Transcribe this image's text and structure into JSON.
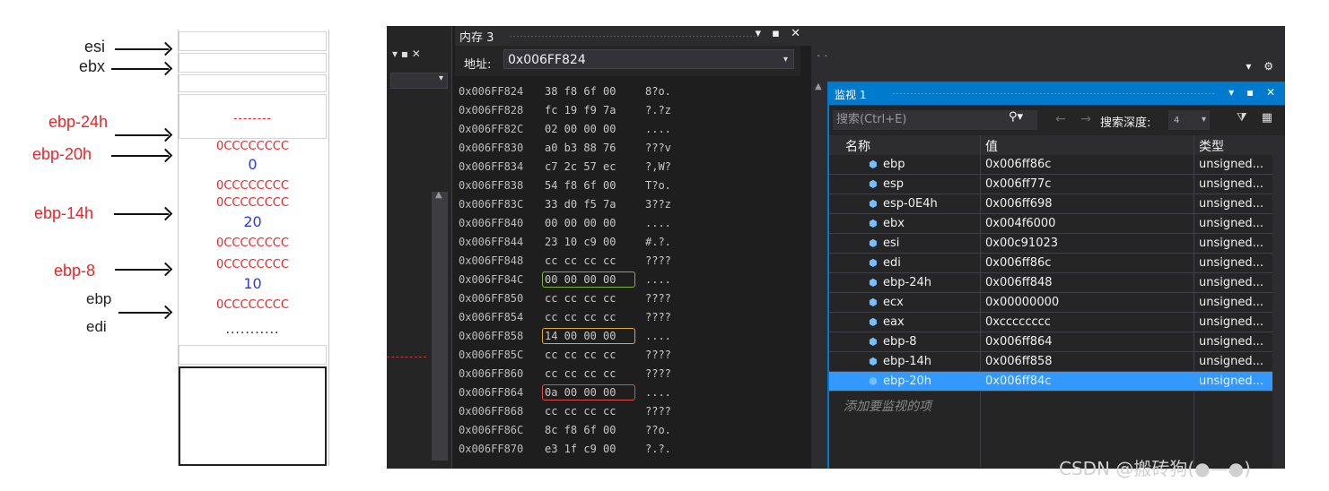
{
  "diagram": {
    "labels": {
      "esi": "esi",
      "ebx": "ebx",
      "ebp_24h": "ebp-24h",
      "ebp_20h": "ebp-20h",
      "ebp_14h": "ebp-14h",
      "ebp_8": "ebp-8",
      "ebp": "ebp",
      "edi": "edi"
    },
    "slots": {
      "dots_top": "--------",
      "cc1": "0CCCCCCCC",
      "val1": "0",
      "cc2": "0CCCCCCCC",
      "cc3": "0CCCCCCCC",
      "val2": "20",
      "cc4": "0CCCCCCCC",
      "cc5": "0CCCCCCCC",
      "val3": "10",
      "cc6": "0CCCCCCCC",
      "dots_bottom": "..........."
    }
  },
  "memory": {
    "title": "内存 3",
    "controls": "▾ ▪ ✕",
    "address_label": "地址:",
    "address_value": "0x006FF824",
    "rows": [
      {
        "addr": "0x006FF824",
        "bytes": "38 f8 6f 00",
        "chars": "8?o."
      },
      {
        "addr": "0x006FF828",
        "bytes": "fc 19 f9 7a",
        "chars": "?.?z"
      },
      {
        "addr": "0x006FF82C",
        "bytes": "02 00 00 00",
        "chars": "...."
      },
      {
        "addr": "0x006FF830",
        "bytes": "a0 b3 88 76",
        "chars": "???v"
      },
      {
        "addr": "0x006FF834",
        "bytes": "c7 2c 57 ec",
        "chars": "?,W?"
      },
      {
        "addr": "0x006FF838",
        "bytes": "54 f8 6f 00",
        "chars": "T?o."
      },
      {
        "addr": "0x006FF83C",
        "bytes": "33 d0 f5 7a",
        "chars": "3??z"
      },
      {
        "addr": "0x006FF840",
        "bytes": "00 00 00 00",
        "chars": "...."
      },
      {
        "addr": "0x006FF844",
        "bytes": "23 10 c9 00",
        "chars": "#.?."
      },
      {
        "addr": "0x006FF848",
        "bytes": "cc cc cc cc",
        "chars": "????"
      },
      {
        "addr": "0x006FF84C",
        "bytes": "00 00 00 00",
        "chars": "...."
      },
      {
        "addr": "0x006FF850",
        "bytes": "cc cc cc cc",
        "chars": "????"
      },
      {
        "addr": "0x006FF854",
        "bytes": "cc cc cc cc",
        "chars": "????"
      },
      {
        "addr": "0x006FF858",
        "bytes": "14 00 00 00",
        "chars": "...."
      },
      {
        "addr": "0x006FF85C",
        "bytes": "cc cc cc cc",
        "chars": "????"
      },
      {
        "addr": "0x006FF860",
        "bytes": "cc cc cc cc",
        "chars": "????"
      },
      {
        "addr": "0x006FF864",
        "bytes": "0a 00 00 00",
        "chars": "...."
      },
      {
        "addr": "0x006FF868",
        "bytes": "cc cc cc cc",
        "chars": "????"
      },
      {
        "addr": "0x006FF86C",
        "bytes": "8c f8 6f 00",
        "chars": "??o."
      },
      {
        "addr": "0x006FF870",
        "bytes": "e3 1f c9 00",
        "chars": "?.?."
      }
    ],
    "highlight_colors": {
      "green": "#7cb342",
      "yellow": "#e0a93c",
      "red": "#e24b4b"
    }
  },
  "watch": {
    "title": "监视 1",
    "search_placeholder": "搜索(Ctrl+E)",
    "search_depth_label": "搜索深度:",
    "search_depth_value": "4",
    "col_name": "名称",
    "col_value": "值",
    "col_type": "类型",
    "rows": [
      {
        "name": "ebp",
        "value": "0x006ff86c",
        "type": "unsigned..."
      },
      {
        "name": "esp",
        "value": "0x006ff77c",
        "type": "unsigned..."
      },
      {
        "name": "esp-0E4h",
        "value": "0x006ff698",
        "type": "unsigned..."
      },
      {
        "name": "ebx",
        "value": "0x004f6000",
        "type": "unsigned..."
      },
      {
        "name": "esi",
        "value": "0x00c91023",
        "type": "unsigned..."
      },
      {
        "name": "edi",
        "value": "0x006ff86c",
        "type": "unsigned..."
      },
      {
        "name": "ebp-24h",
        "value": "0x006ff848",
        "type": "unsigned..."
      },
      {
        "name": "ecx",
        "value": "0x00000000",
        "type": "unsigned..."
      },
      {
        "name": "eax",
        "value": "0xcccccccc",
        "type": "unsigned..."
      },
      {
        "name": "ebp-8",
        "value": "0x006ff864",
        "type": "unsigned..."
      },
      {
        "name": "ebp-14h",
        "value": "0x006ff858",
        "type": "unsigned..."
      },
      {
        "name": "ebp-20h",
        "value": "0x006ff84c",
        "type": "unsigned..."
      }
    ],
    "add_watch": "添加要监视的项"
  },
  "watermark": "CSDN @搬砖狗(●—●)",
  "colors": {
    "accent": "#007acc",
    "selection": "#3399ff",
    "vs_bg": "#1e1e1e",
    "diagram_red": "#e8262a",
    "diagram_blue": "#2b3dd6"
  }
}
